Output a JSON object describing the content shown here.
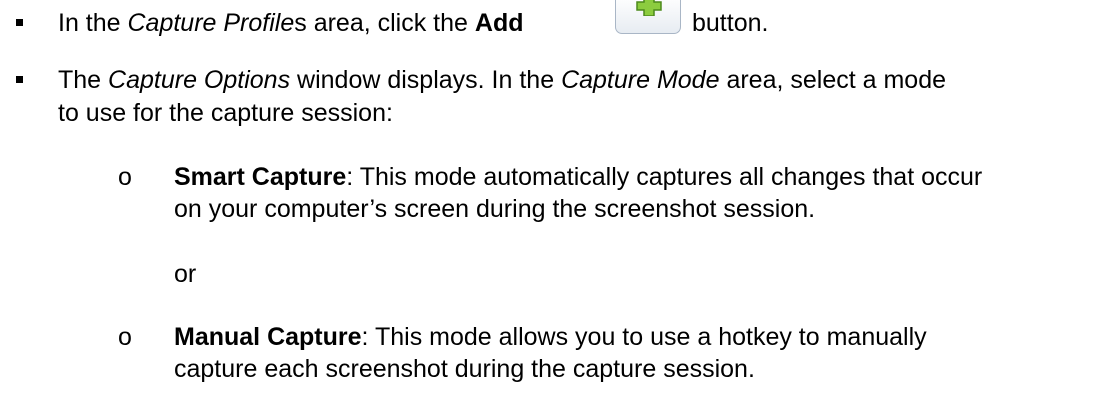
{
  "step1": {
    "prefix": "In the ",
    "area_italic": "Capture Profile",
    "area_suffix": "s area, click the ",
    "button_bold": "Add",
    "suffix": "button."
  },
  "step2": {
    "prefix": "The ",
    "window_italic": "Capture Options",
    "mid": " window displays. In the ",
    "area_italic": "Capture Mode",
    "suffix_line1": " area, select a mode",
    "line2": "to use for the capture session:"
  },
  "options": {
    "marker": "o",
    "smart": {
      "title": "Smart Capture",
      "text_line1": ": This mode automatically captures all changes that occur",
      "text_line2": "on your computer’s screen during the screenshot session."
    },
    "or_text": "or",
    "manual": {
      "title": "Manual Capture",
      "text_line1": ": This mode allows you to use a hotkey to manually",
      "text_line2": "capture each screenshot during the capture session."
    }
  },
  "icon": {
    "add_icon": "green-plus-icon",
    "add_color": "#8ccc3f",
    "add_border": "#4d8a1c"
  }
}
